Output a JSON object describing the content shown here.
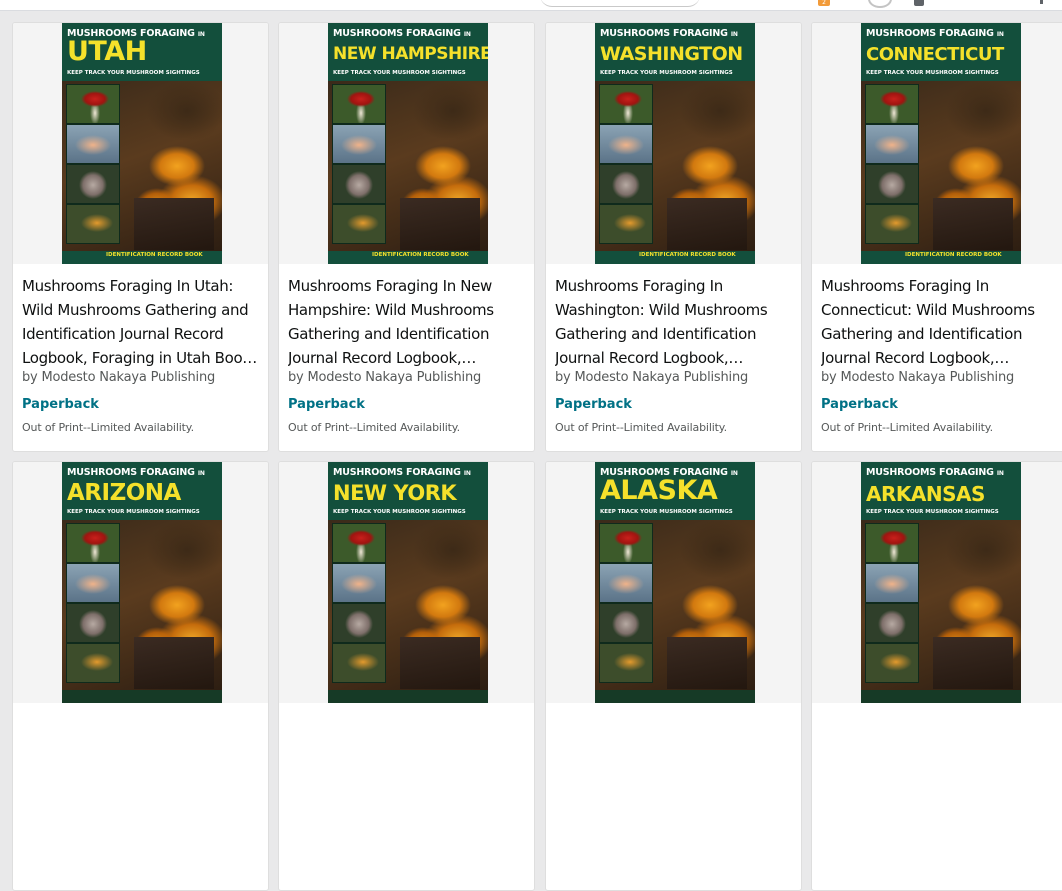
{
  "browser": {
    "extension_badge": "2"
  },
  "cover_common": {
    "top_line": "MUSHROOMS FORAGING",
    "top_line_suffix": "IN",
    "sub_line": "KEEP TRACK YOUR MUSHROOM SIGHTINGS",
    "footer": "IDENTIFICATION RECORD BOOK"
  },
  "books": [
    {
      "state": "UTAH",
      "title": "Mushrooms Foraging In Utah: Wild Mushrooms Gathering and Identification Journal Record Logbook, Foraging in Utah Boo…",
      "byline": "by Modesto Nakaya Publishing",
      "format": "Paperback",
      "availability": "Out of Print--Limited Availability."
    },
    {
      "state": "NEW HAMPSHIRE",
      "title": "Mushrooms Foraging In New Hampshire: Wild Mushrooms Gathering and Identification Journal Record Logbook,…",
      "byline": "by Modesto Nakaya Publishing",
      "format": "Paperback",
      "availability": "Out of Print--Limited Availability."
    },
    {
      "state": "WASHINGTON",
      "title": "Mushrooms Foraging In Washington: Wild Mushrooms Gathering and Identification Journal Record Logbook,…",
      "byline": "by Modesto Nakaya Publishing",
      "format": "Paperback",
      "availability": "Out of Print--Limited Availability."
    },
    {
      "state": "CONNECTICUT",
      "title": "Mushrooms Foraging In Connecticut: Wild Mushrooms Gathering and Identification Journal Record Logbook,…",
      "byline": "by Modesto Nakaya Publishing",
      "format": "Paperback",
      "availability": "Out of Print--Limited Availability."
    },
    {
      "state": "ARIZONA"
    },
    {
      "state": "NEW YORK"
    },
    {
      "state": "ALASKA"
    },
    {
      "state": "ARKANSAS"
    }
  ]
}
